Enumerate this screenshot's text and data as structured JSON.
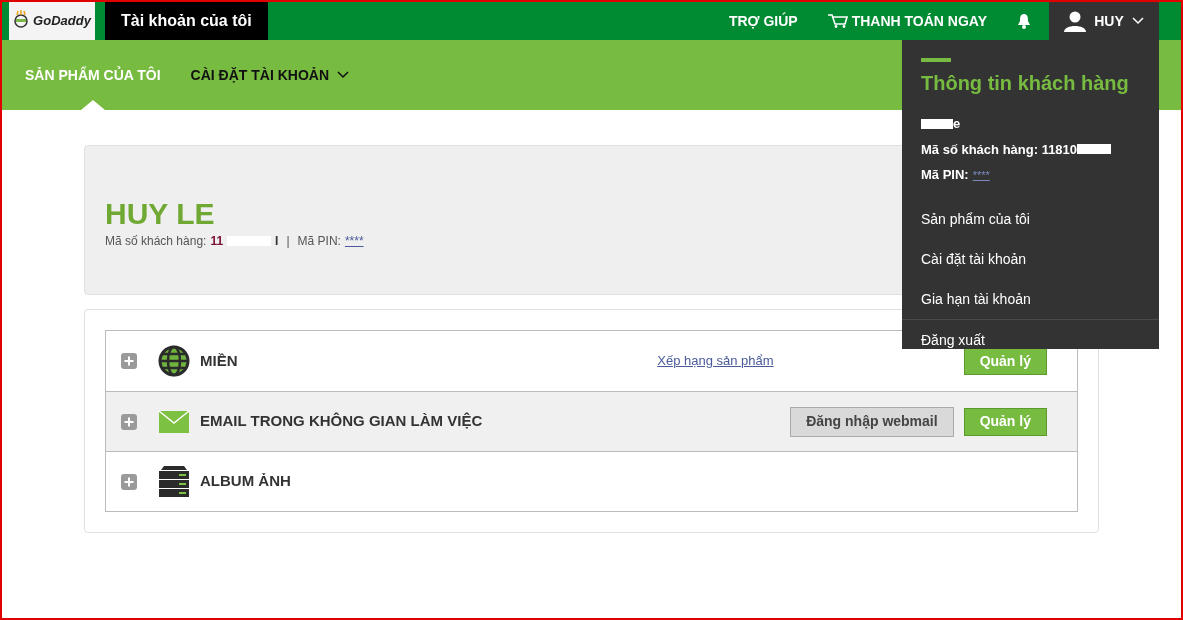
{
  "top_bar": {
    "logo_text": "GoDaddy",
    "title": "Tài khoản của tôi",
    "links": [
      {
        "kind": "text",
        "label": "TRỢ GIÚP"
      },
      {
        "kind": "cart",
        "label": "THANH TOÁN NGAY"
      },
      {
        "kind": "bell"
      }
    ],
    "user": {
      "label": "HUY",
      "expanded": true
    }
  },
  "nav": [
    {
      "label": "SẢN PHẨM CỦA TÔI",
      "selected": true,
      "dropdown": false
    },
    {
      "label": "CÀI ĐẶT TÀI KHOẢN",
      "selected": false,
      "dropdown": true
    }
  ],
  "account": {
    "name": "HUY LE",
    "id_label": "Mã số khách hàng:",
    "id_visible": "11",
    "id_tail": "I",
    "separator": "|",
    "pin_label": "Mã PIN:",
    "pin": "****"
  },
  "products": [
    {
      "kind": "globe",
      "name": "MIỀN",
      "link": "Xếp hạng sản phẩm",
      "buttons": [
        {
          "kind": "primary",
          "label": "Quản lý"
        }
      ],
      "shaded": false
    },
    {
      "kind": "envelope",
      "name": "EMAIL TRONG KHÔNG GIAN LÀM VIỆC",
      "buttons": [
        {
          "kind": "secondary",
          "label": "Đăng nhập webmail"
        },
        {
          "kind": "primary",
          "label": "Quản lý"
        }
      ],
      "shaded": true
    },
    {
      "kind": "server",
      "name": "ALBUM ẢNH",
      "shaded": false
    }
  ],
  "dropdown": {
    "title": "Thông tin khách hàng",
    "name_visible": "e",
    "id_label": "Mã số khách hàng: 11810",
    "pin_label": "Mã PIN:",
    "pin": "****",
    "items": [
      {
        "label": "Sản phẩm của tôi",
        "divider": false
      },
      {
        "label": "Cài đặt tài khoản",
        "divider": false
      },
      {
        "label": "Gia hạn tài khoản",
        "divider": false
      },
      {
        "label": "Đăng xuất",
        "divider": true
      }
    ]
  }
}
